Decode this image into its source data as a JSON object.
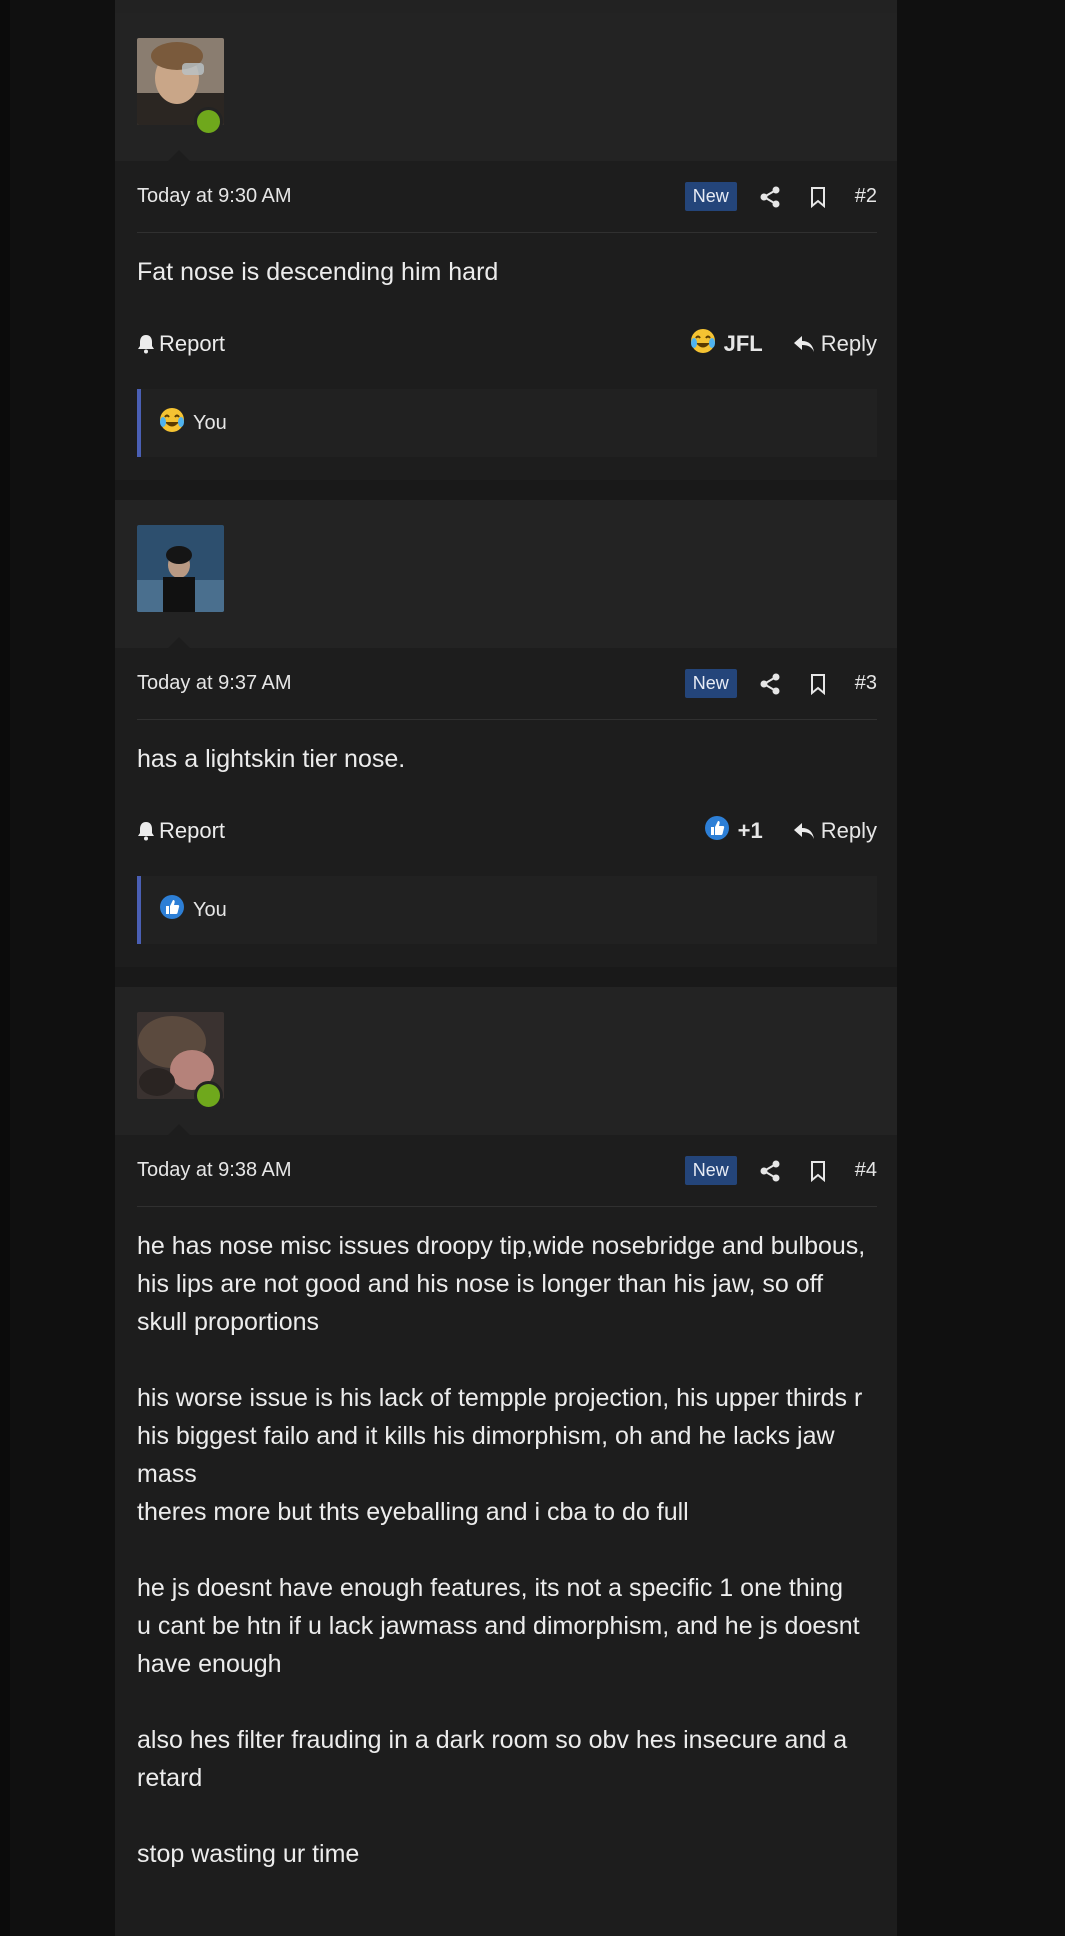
{
  "posts": [
    {
      "time": "Today at 9:30 AM",
      "badge": "New",
      "number": "#2",
      "message": "Fat nose is descending him hard",
      "report_label": "Report",
      "reaction_label": "JFL",
      "reaction_icon": "laughing-crying-emoji-icon",
      "reply_label": "Reply",
      "reactor": "You",
      "online": true
    },
    {
      "time": "Today at 9:37 AM",
      "badge": "New",
      "number": "#3",
      "message": "has a lightskin tier nose.",
      "report_label": "Report",
      "reaction_label": "+1",
      "reaction_icon": "thumbs-up-icon",
      "reply_label": "Reply",
      "reactor": "You",
      "online": false
    },
    {
      "time": "Today at 9:38 AM",
      "badge": "New",
      "number": "#4",
      "paragraphs": [
        "he has nose misc issues droopy tip,wide nosebridge and bulbous, his lips are not good and his nose is longer than his jaw, so off skull proportions",
        "his worse issue is his lack of tempple projection, his upper thirds r his biggest failo and it kills his dimorphism, oh and he lacks jaw mass\ntheres more but thts eyeballing and i cba to do full",
        "he js doesnt have enough features, its not a specific 1 one thing\nu cant be htn if u lack jawmass and dimorphism, and he js doesnt have enough",
        "also hes filter frauding in a dark room so obv hes insecure and a retard",
        "stop wasting ur time"
      ],
      "online": true
    }
  ],
  "colors": {
    "badge_bg": "#24457a",
    "online": "#6fa81c",
    "reactor_border": "#4a5fb4",
    "like_blue": "#2d7fd6"
  }
}
